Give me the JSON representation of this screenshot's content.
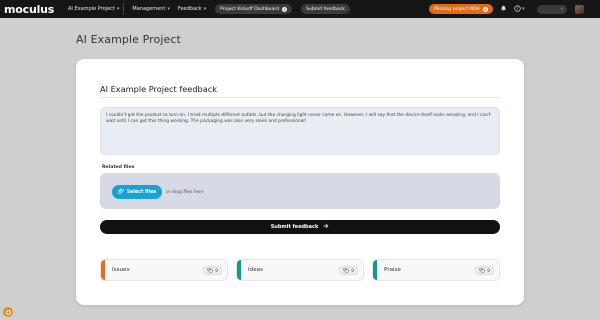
{
  "app": {
    "logo": "moculus"
  },
  "nav": {
    "items": [
      {
        "label": "AI Example Project"
      },
      {
        "label": "Management"
      },
      {
        "label": "Feedback"
      }
    ],
    "dashboard_pill": "Project Kickoff Dashboard",
    "submit_pill": "Submit feedback",
    "missing_pill": "Missing project NDA",
    "search_icon": "⌕"
  },
  "page": {
    "title": "AI Example Project"
  },
  "card": {
    "title": "AI Example Project feedback",
    "feedback_text": "I couldn't get the product to turn on. I tried multiple different outlets, but the charging light never came on. However, I will say that the device itself looks amazing, and I can't wait until I can get this thing working. The packaging was also very sleek and professional!",
    "related_files_label": "Related files",
    "select_files_label": "Select files",
    "drag_text": "or drag files here",
    "submit_label": "Submit feedback",
    "categories": [
      {
        "label": "Issues",
        "count": "0",
        "color": "#e0711e"
      },
      {
        "label": "Ideas",
        "count": "0",
        "color": "#139a8c"
      },
      {
        "label": "Praise",
        "count": "0",
        "color": "#139a8c"
      }
    ]
  },
  "colors": {
    "accent_blue": "#17a2d6",
    "accent_orange": "#e06c14",
    "nav_bg": "#161616"
  }
}
